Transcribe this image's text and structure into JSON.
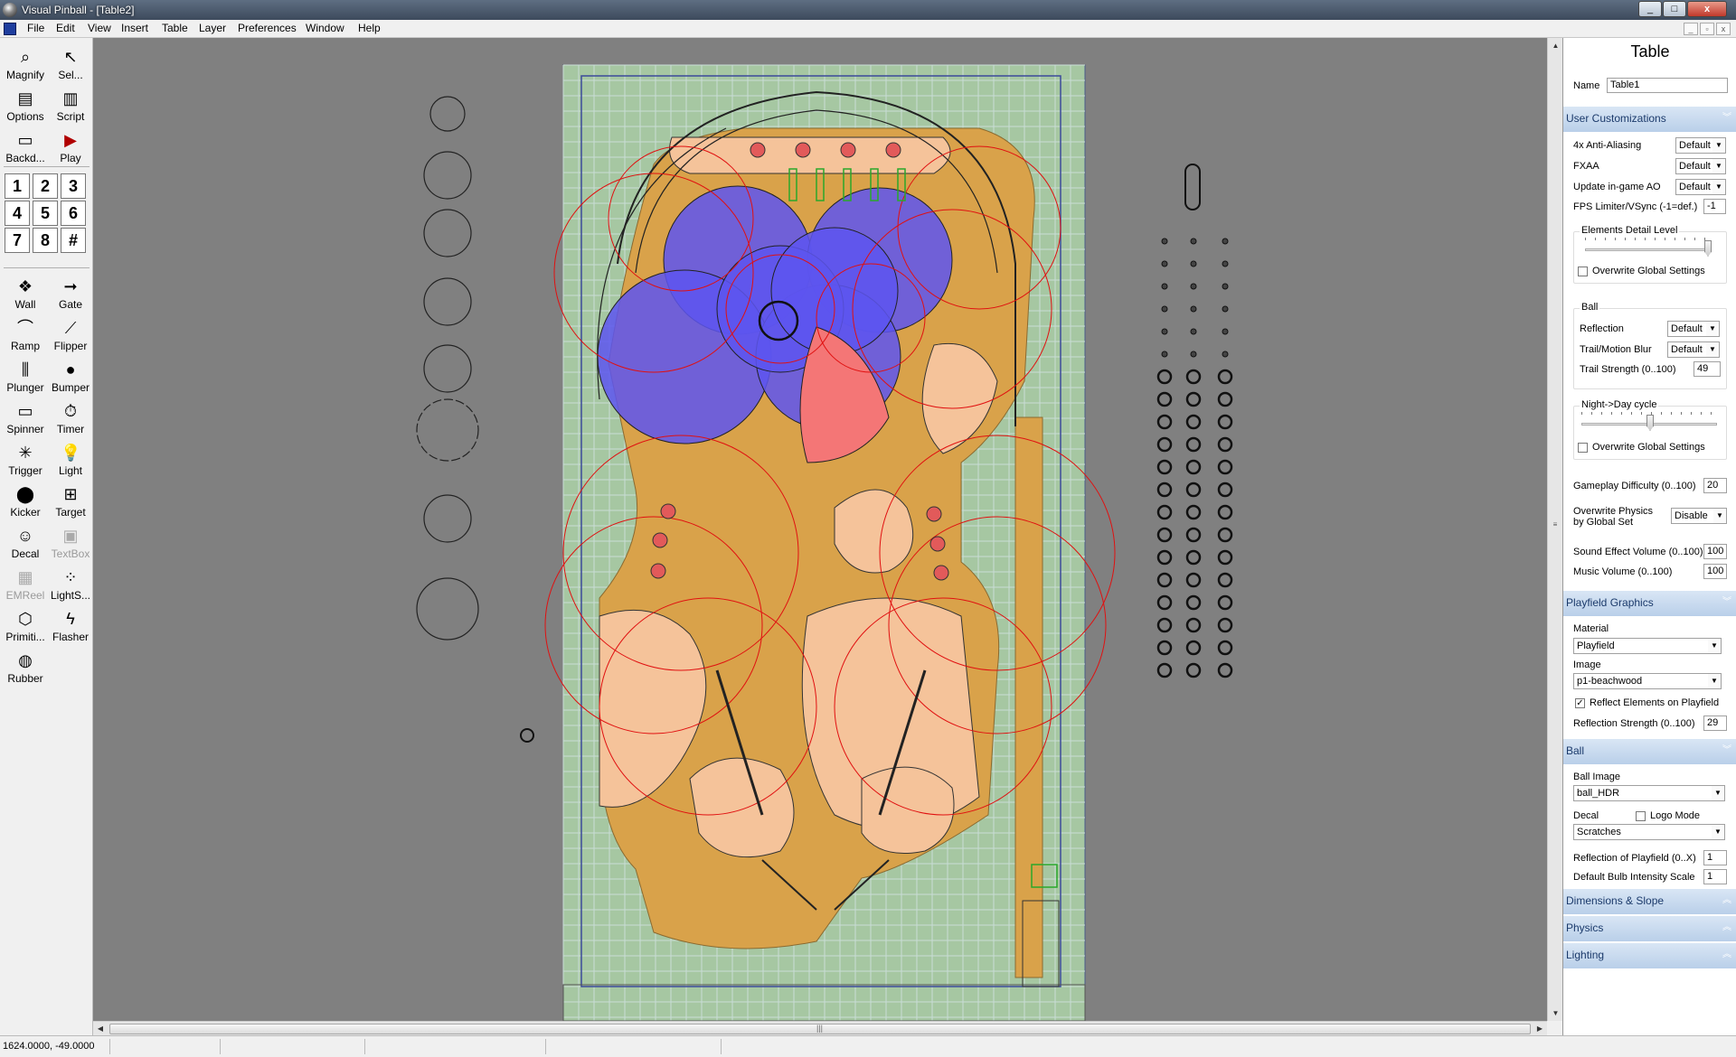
{
  "window": {
    "title": "Visual Pinball - [Table2]",
    "min": "_",
    "max": "□",
    "close": "x"
  },
  "menu": [
    "File",
    "Edit",
    "View",
    "Insert",
    "Table",
    "Layer",
    "Preferences",
    "Window",
    "Help"
  ],
  "toolbox": {
    "top": [
      {
        "label": "Magnify",
        "icon": "magnify-icon",
        "glyph": "⌕"
      },
      {
        "label": "Sel...",
        "icon": "select-arrow-icon",
        "glyph": "↖"
      },
      {
        "label": "Options",
        "icon": "options-icon",
        "glyph": "▤"
      },
      {
        "label": "Script",
        "icon": "script-icon",
        "glyph": "▥"
      },
      {
        "label": "Backd...",
        "icon": "backdrop-icon",
        "glyph": "▭"
      },
      {
        "label": "Play",
        "icon": "play-icon",
        "glyph": "▶"
      }
    ],
    "numbers": [
      "1",
      "2",
      "3",
      "4",
      "5",
      "6",
      "7",
      "8",
      "#"
    ],
    "elements": [
      {
        "label": "Wall",
        "icon": "wall-icon",
        "glyph": "❖",
        "enabled": true
      },
      {
        "label": "Gate",
        "icon": "gate-icon",
        "glyph": "➞",
        "enabled": true
      },
      {
        "label": "Ramp",
        "icon": "ramp-icon",
        "glyph": "⌒",
        "enabled": true
      },
      {
        "label": "Flipper",
        "icon": "flipper-icon",
        "glyph": "⟋",
        "enabled": true
      },
      {
        "label": "Plunger",
        "icon": "plunger-icon",
        "glyph": "⫼",
        "enabled": true
      },
      {
        "label": "Bumper",
        "icon": "bumper-icon",
        "glyph": "●",
        "enabled": true
      },
      {
        "label": "Spinner",
        "icon": "spinner-icon",
        "glyph": "▭",
        "enabled": true
      },
      {
        "label": "Timer",
        "icon": "timer-icon",
        "glyph": "⏱",
        "enabled": true
      },
      {
        "label": "Trigger",
        "icon": "trigger-icon",
        "glyph": "✳",
        "enabled": true
      },
      {
        "label": "Light",
        "icon": "light-bulb-icon",
        "glyph": "💡",
        "enabled": true
      },
      {
        "label": "Kicker",
        "icon": "kicker-icon",
        "glyph": "⬤",
        "enabled": true
      },
      {
        "label": "Target",
        "icon": "target-icon",
        "glyph": "⊞",
        "enabled": true
      },
      {
        "label": "Decal",
        "icon": "decal-icon",
        "glyph": "☺",
        "enabled": true
      },
      {
        "label": "TextBox",
        "icon": "textbox-icon",
        "glyph": "▣",
        "enabled": false
      },
      {
        "label": "EMReel",
        "icon": "emreel-icon",
        "glyph": "▦",
        "enabled": false
      },
      {
        "label": "LightS...",
        "icon": "lightsequencer-icon",
        "glyph": "⁘",
        "enabled": true
      },
      {
        "label": "Primiti...",
        "icon": "primitive-icon",
        "glyph": "⬡",
        "enabled": true
      },
      {
        "label": "Flasher",
        "icon": "flasher-icon",
        "glyph": "ϟ",
        "enabled": true
      },
      {
        "label": "Rubber",
        "icon": "rubber-icon",
        "glyph": "◍",
        "enabled": true
      }
    ]
  },
  "colors": {
    "playfield": "#a6c7a2",
    "wood": "#d9a24a",
    "peach": "#f5c39a",
    "blue_circle": "#5d55f0",
    "red_fill": "#f47676",
    "guide_red": "#e01010",
    "canvas_bg": "#808080"
  },
  "properties": {
    "title": "Table",
    "name_label": "Name",
    "name_value": "Table1",
    "user_custom": {
      "header": "User Customizations",
      "aa_label": "4x Anti-Aliasing",
      "aa_value": "Default",
      "fxaa_label": "FXAA",
      "fxaa_value": "Default",
      "ao_label": "Update in-game AO",
      "ao_value": "Default",
      "fps_label": "FPS Limiter/VSync (-1=def.)",
      "fps_value": "-1",
      "detail_group": "Elements Detail Level",
      "detail_overwrite": "Overwrite Global Settings",
      "ball_group": "Ball",
      "reflection_label": "Reflection",
      "reflection_value": "Default",
      "trail_blur_label": "Trail/Motion Blur",
      "trail_blur_value": "Default",
      "trail_strength_label": "Trail Strength (0..100)",
      "trail_strength_value": "49",
      "night_group": "Night->Day cycle",
      "night_overwrite": "Overwrite Global Settings",
      "difficulty_label": "Gameplay Difficulty (0..100)",
      "difficulty_value": "20",
      "overwrite_physics_label1": "Overwrite Physics",
      "overwrite_physics_label2": "by Global Set",
      "overwrite_physics_value": "Disable",
      "sound_label": "Sound Effect Volume (0..100)",
      "sound_value": "100",
      "music_label": "Music Volume (0..100)",
      "music_value": "100"
    },
    "playfield": {
      "header": "Playfield Graphics",
      "material_label": "Material",
      "material_value": "Playfield",
      "image_label": "Image",
      "image_value": "p1-beachwood",
      "reflect_label": "Reflect Elements on Playfield",
      "reflection_strength_label": "Reflection Strength (0..100)",
      "reflection_strength_value": "29"
    },
    "ball": {
      "header": "Ball",
      "ball_image_label": "Ball Image",
      "ball_image_value": "ball_HDR",
      "decal_label": "Decal",
      "logo_mode_label": "Logo Mode",
      "decal_value": "Scratches",
      "reflection_pf_label": "Reflection of Playfield (0..X)",
      "reflection_pf_value": "1",
      "bulb_label": "Default Bulb Intensity Scale",
      "bulb_value": "1"
    },
    "collapsed": [
      "Dimensions & Slope",
      "Physics",
      "Lighting"
    ]
  },
  "status": {
    "coords": "1624.0000, -49.0000"
  }
}
